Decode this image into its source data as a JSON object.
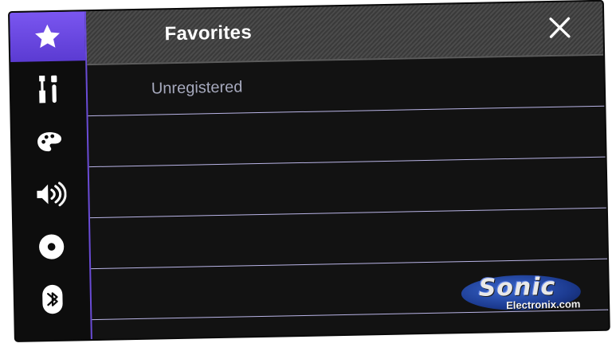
{
  "sidebar": {
    "items": [
      {
        "icon": "star-icon",
        "active": true
      },
      {
        "icon": "tools-icon",
        "active": false
      },
      {
        "icon": "palette-icon",
        "active": false
      },
      {
        "icon": "speaker-icon",
        "active": false
      },
      {
        "icon": "disc-icon",
        "active": false
      },
      {
        "icon": "bluetooth-icon",
        "active": false
      }
    ],
    "accent_color": "#6a4cd6"
  },
  "header": {
    "title": "Favorites",
    "close_icon": "close-icon"
  },
  "favorites": {
    "rows": [
      {
        "label": "Unregistered"
      },
      {
        "label": ""
      },
      {
        "label": ""
      },
      {
        "label": ""
      },
      {
        "label": ""
      }
    ]
  },
  "watermark": {
    "brand": "Sonic",
    "site": "Electronix.com"
  }
}
